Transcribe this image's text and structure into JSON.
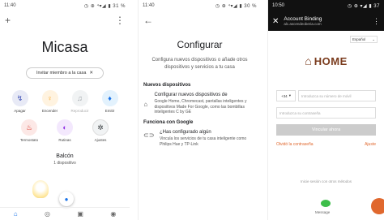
{
  "p1": {
    "status": {
      "time": "11:40",
      "right": "◷ ⊕ ⁴▾◢ ▮ 31 %"
    },
    "title": "Micasa",
    "invite": "Invitar miembro a la casa",
    "row1": [
      {
        "label": "Apagar",
        "icon": "↯",
        "bg": "#e8eaf6",
        "fg": "#3f51b5"
      },
      {
        "label": "Encender",
        "icon": "♀",
        "bg": "#fff3e0",
        "fg": "#f9a825"
      },
      {
        "label": "Reproducir",
        "icon": "♫",
        "bg": "#f1f3f4",
        "fg": "#9aa0a6"
      },
      {
        "label": "Emitir",
        "icon": "♦",
        "bg": "#e3f2fd",
        "fg": "#1a73e8"
      }
    ],
    "row2": [
      {
        "label": "Termostato",
        "icon": "♨",
        "bg": "#fce8e6",
        "fg": "#d93025"
      },
      {
        "label": "Rutinas",
        "icon": "◐",
        "bg": "#f3e8fd",
        "fg": "#9334e6"
      },
      {
        "label": "Ajustes",
        "icon": "✲",
        "bg": "#f1f3f4",
        "fg": "#3c4043"
      }
    ],
    "room": "Balcón",
    "room_count": "1 dispositivo"
  },
  "p2": {
    "status": {
      "time": "11:40",
      "right": "◷ ⊕ ⁴▾◢ ▮ 30 %"
    },
    "title": "Configurar",
    "subtitle": "Configura nuevos dispositivos o añade otros dispositivos y servicios a tu casa",
    "section1": "Nuevos dispositivos",
    "item1_title": "Configurar nuevos dispositivos de",
    "item1_sub": "Google Home, Chromecast, pantallas inteligentes y dispositivos Made For Google, como las bombillas inteligentes C by GE",
    "section2": "Funciona con Google",
    "item2_title": "¿Has configurado algún",
    "item2_sub": "Vincula los servicios de tu casa inteligente como Philips Hue y TP-Link"
  },
  "p3": {
    "status": {
      "time": "10:50",
      "right": "◷ ⊕ ▾◢ ▮ 37"
    },
    "header_title": "Account Binding",
    "header_url": "alc.ascendeoberia.com",
    "language": "Español",
    "logo_text": "HOME",
    "country_code": "+34",
    "phone_placeholder": "Introduzca su número de móvil",
    "password_placeholder": "Introduzca su contraseña",
    "bind_button": "Vincular ahora",
    "forgot": "Olvidó la contraseña",
    "register": "Ajuste",
    "other_methods": "Inicie sesión con otros métodos",
    "message_label": "Message"
  }
}
